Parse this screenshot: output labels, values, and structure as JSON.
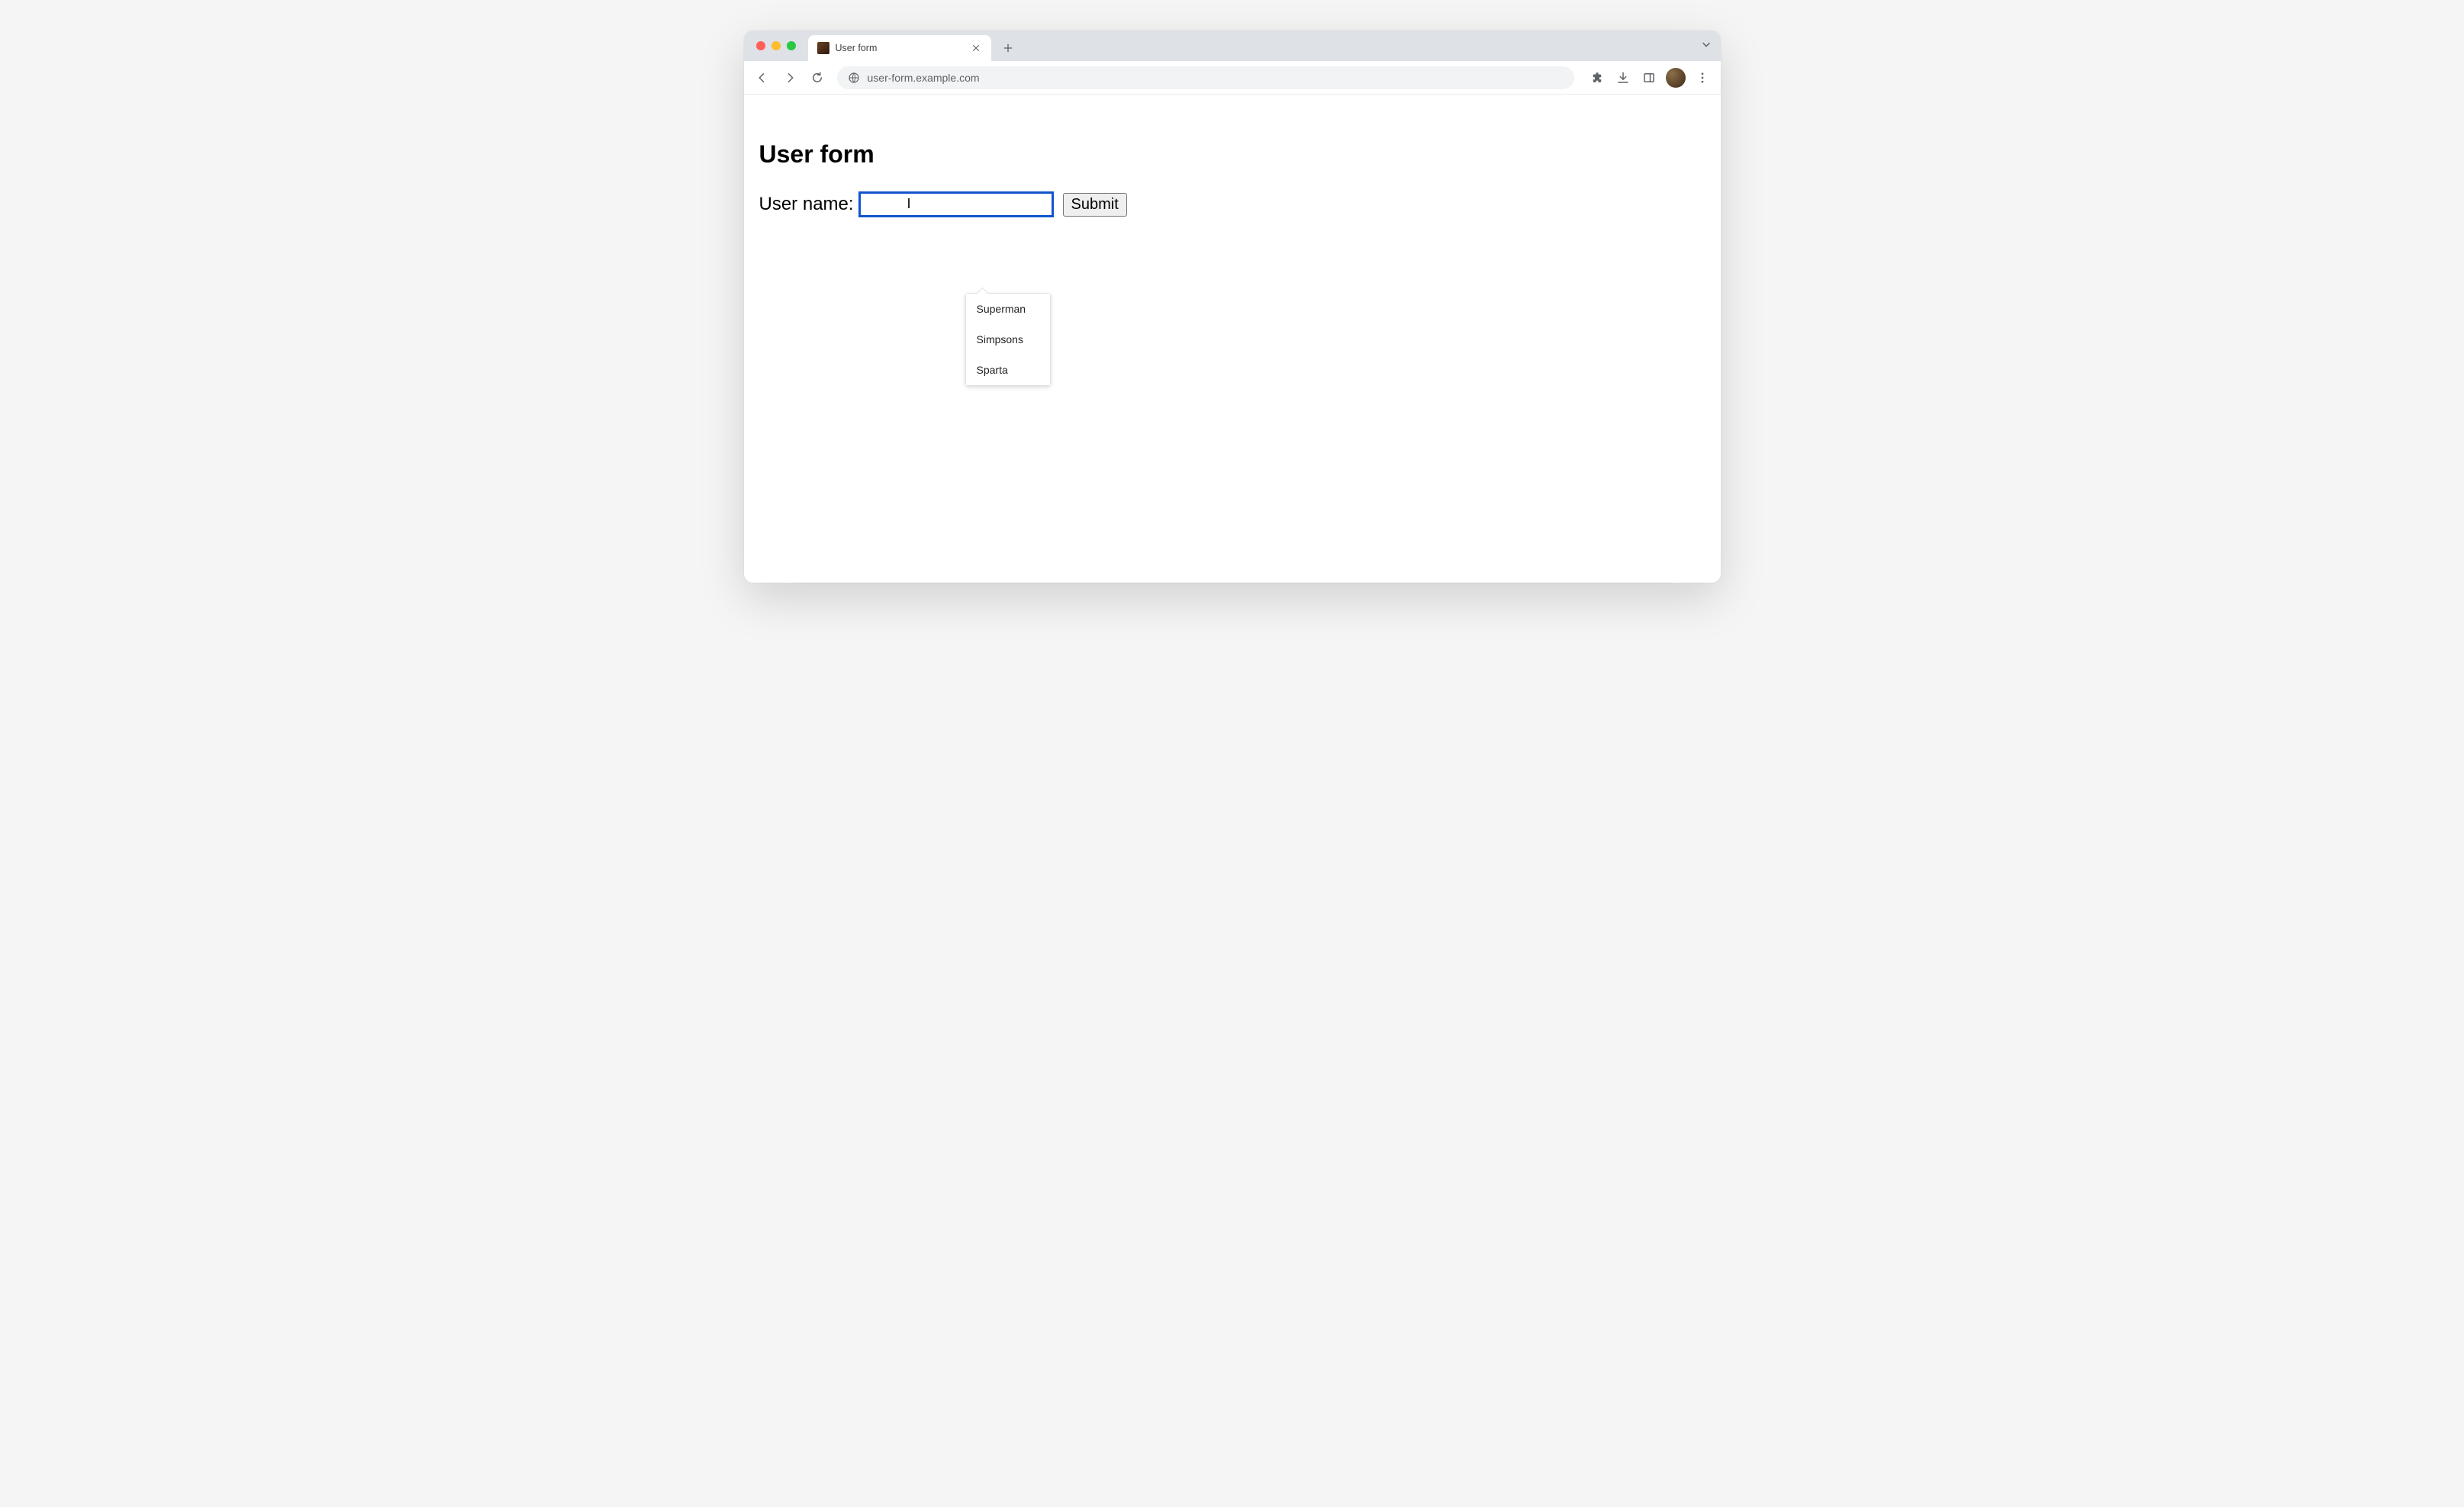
{
  "browser": {
    "tab_title": "User form",
    "url": "user-form.example.com"
  },
  "page": {
    "heading": "User form",
    "form": {
      "label": "User name:",
      "input_value": "",
      "submit_label": "Submit"
    },
    "autocomplete": {
      "items": [
        "Superman",
        "Simpsons",
        "Sparta"
      ]
    }
  }
}
